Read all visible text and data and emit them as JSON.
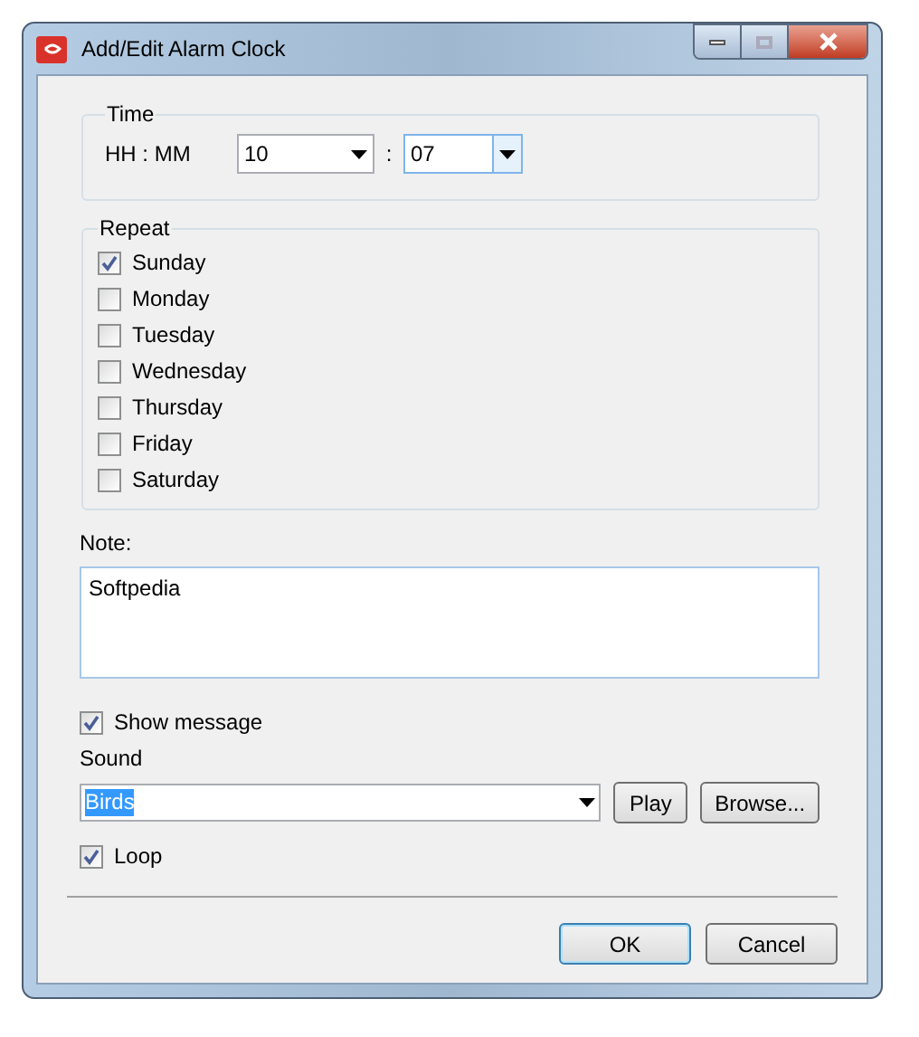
{
  "window": {
    "title": "Add/Edit Alarm Clock"
  },
  "time": {
    "title": "Time",
    "label": "HH : MM",
    "hour": "10",
    "separator": ":",
    "minute": "07"
  },
  "repeat": {
    "title": "Repeat",
    "days": [
      {
        "label": "Sunday",
        "checked": true
      },
      {
        "label": "Monday",
        "checked": false
      },
      {
        "label": "Tuesday",
        "checked": false
      },
      {
        "label": "Wednesday",
        "checked": false
      },
      {
        "label": "Thursday",
        "checked": false
      },
      {
        "label": "Friday",
        "checked": false
      },
      {
        "label": "Saturday",
        "checked": false
      }
    ]
  },
  "note": {
    "label": "Note:",
    "value": "Softpedia"
  },
  "show_message": {
    "label": "Show message",
    "checked": true
  },
  "sound": {
    "label": "Sound",
    "value": "Birds",
    "play": "Play",
    "browse": "Browse..."
  },
  "loop": {
    "label": "Loop",
    "checked": true
  },
  "buttons": [
    {
      "label": "OK",
      "default": true
    },
    {
      "label": "Cancel",
      "default": false
    }
  ]
}
